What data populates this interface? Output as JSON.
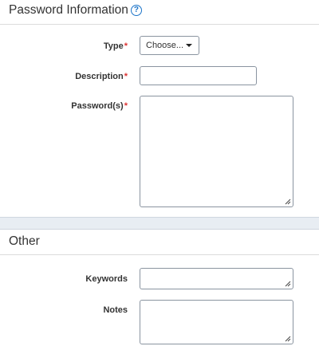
{
  "password_section": {
    "title": "Password Information",
    "help_icon": "question-circle-icon",
    "fields": {
      "type_label": "Type",
      "type_selected": "Choose...",
      "description_label": "Description",
      "passwords_label": "Password(s)",
      "required_marker": "*"
    }
  },
  "other_section": {
    "title": "Other",
    "fields": {
      "keywords_label": "Keywords",
      "notes_label": "Notes"
    }
  },
  "colors": {
    "accent": "#1a73c8",
    "required": "#d33333",
    "border": "#8a94a0"
  }
}
